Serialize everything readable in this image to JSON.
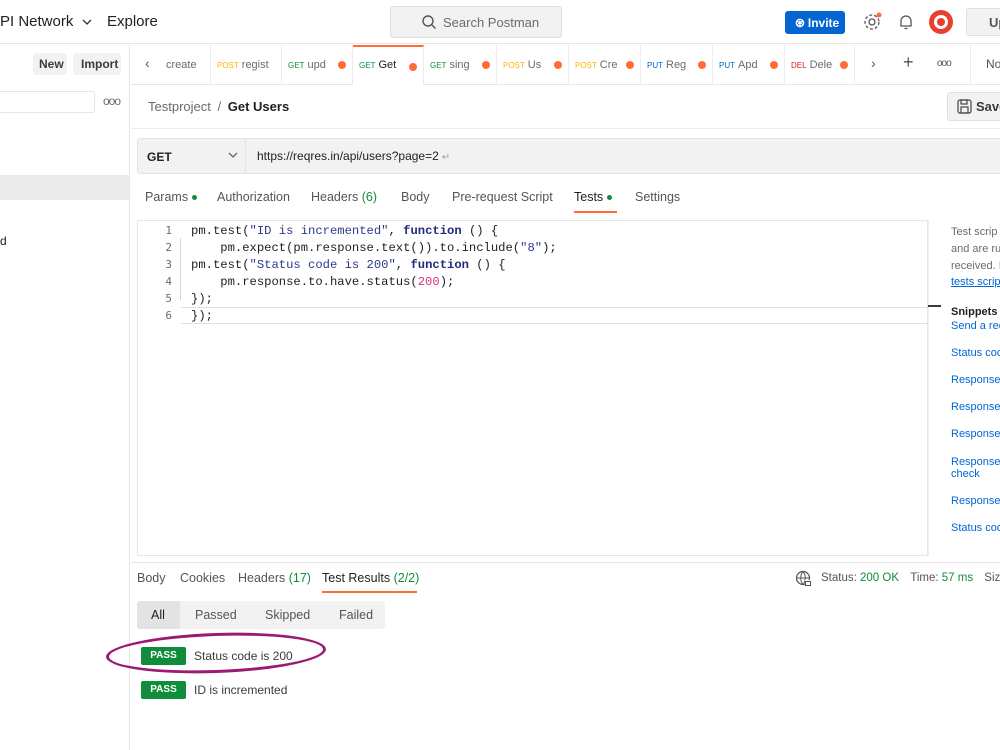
{
  "topbar": {
    "network": "PI Network",
    "explore": "Explore",
    "search_placeholder": "Search Postman",
    "invite": "Invite",
    "upgrade": "Up"
  },
  "sidebar": {
    "new": "New",
    "import": "Import",
    "more": "ooo",
    "partial_item": "d"
  },
  "tabs": [
    {
      "method": "",
      "label": "create",
      "dirty": false
    },
    {
      "method": "POST",
      "label": "regist",
      "dirty": false
    },
    {
      "method": "GET",
      "label": "upd",
      "dirty": true
    },
    {
      "method": "GET",
      "label": "Get",
      "dirty": true,
      "active": true
    },
    {
      "method": "GET",
      "label": "sing",
      "dirty": true
    },
    {
      "method": "POST",
      "label": "Us",
      "dirty": true
    },
    {
      "method": "POST",
      "label": "Cre",
      "dirty": true
    },
    {
      "method": "PUT",
      "label": "Reg",
      "dirty": true
    },
    {
      "method": "PUT",
      "label": "Apd",
      "dirty": true
    },
    {
      "method": "DEL",
      "label": "Dele",
      "dirty": true
    }
  ],
  "tabs_more": "ooo",
  "tabs_env": "No",
  "breadcrumb": {
    "parent": "Testproject",
    "sep": "/",
    "current": "Get Users"
  },
  "save": "Save",
  "request": {
    "method": "GET",
    "url": "https://reqres.in/api/users?page=2",
    "return_glyph": "↵"
  },
  "request_tabs": {
    "params": "Params",
    "authorization": "Authorization",
    "headers": "Headers",
    "headers_count": "(6)",
    "body": "Body",
    "prerequest": "Pre-request Script",
    "tests": "Tests",
    "settings": "Settings"
  },
  "editor": {
    "line_numbers": [
      "1",
      "2",
      "3",
      "4",
      "5",
      "6"
    ],
    "lines": [
      {
        "a": "pm.test(",
        "s": "\"ID is incremented\"",
        "b": ", ",
        "k": "function",
        "c": " () {"
      },
      {
        "a": "    pm.expect(pm.response.text()).to.include(",
        "s": "\"8\"",
        "c": ");"
      },
      {
        "a": "pm.test(",
        "s": "\"Status code is 200\"",
        "b": ", ",
        "k": "function",
        "c": " () {"
      },
      {
        "a": "    pm.response.to.have.status(",
        "n": "200",
        "c": ");"
      },
      {
        "a": "});"
      },
      {
        "a": "});"
      }
    ]
  },
  "snippets": {
    "desc1": "Test scrip",
    "desc2": "and are ru",
    "desc3": "received. I",
    "desc_link": "tests scrip",
    "heading": "Snippets",
    "items": [
      "Send a req",
      "Status cod",
      "Response",
      "Response",
      "Response",
      "Response",
      "check",
      "Response",
      "Status cod",
      "Status cod"
    ]
  },
  "response": {
    "tabs": {
      "body": "Body",
      "cookies": "Cookies",
      "headers": "Headers",
      "headers_count": "(17)",
      "test_results": "Test Results",
      "test_count": "(2/2)"
    },
    "status_label": "Status:",
    "status_value": "200 OK",
    "time_label": "Time:",
    "time_value": "57 ms",
    "size_label": "Size"
  },
  "filters": {
    "all": "All",
    "passed": "Passed",
    "skipped": "Skipped",
    "failed": "Failed"
  },
  "results": [
    {
      "status": "PASS",
      "name": "Status code is 200"
    },
    {
      "status": "PASS",
      "name": "ID is incremented"
    }
  ]
}
